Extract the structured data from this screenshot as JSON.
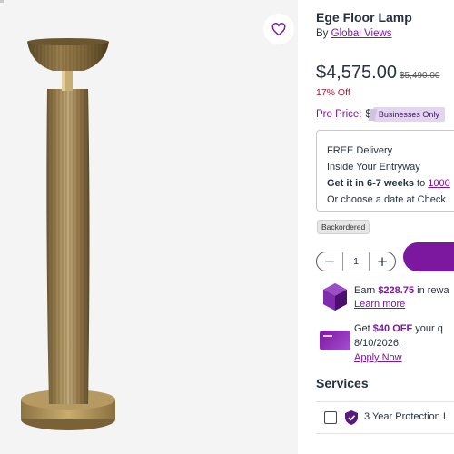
{
  "product": {
    "title": "Ege Floor Lamp",
    "by_prefix": "By",
    "brand": "Global Views"
  },
  "pricing": {
    "price": "$4,575.00",
    "old_price": "$5,490.00",
    "discount": "17% Off",
    "pro_label": "Pro Price:",
    "pro_dollar": "$",
    "pro_badge": "Businesses Only"
  },
  "delivery": {
    "line1": "FREE Delivery",
    "line2": "Inside Your Entryway",
    "line3_prefix": "Get it in 6-7 weeks",
    "line3_mid": "to",
    "line3_link": "1000",
    "line4": "Or choose a date at Check"
  },
  "stock_status": "Backordered",
  "quantity": {
    "value": "1",
    "minus": "−",
    "plus": "+"
  },
  "rewards": {
    "earn_prefix": "Earn",
    "earn_amount": "$228.75",
    "earn_suffix": "in rewa",
    "learn_more": "Learn more"
  },
  "offer": {
    "get_prefix": "Get",
    "amount": "$40 OFF",
    "suffix": "your q",
    "date": "8/10/2026.",
    "apply": "Apply Now"
  },
  "services": {
    "title": "Services",
    "protection_label": "3 Year Protection I"
  },
  "colors": {
    "brand_purple": "#7b189f",
    "discount_red": "#a8163a",
    "badge_bg": "#e3d4f2",
    "image_bg": "#f4f4f4"
  },
  "icons": {
    "favorite": "heart-icon",
    "rewards": "rewards-gem-icon",
    "card": "credit-card-icon",
    "protection": "shield-icon"
  }
}
